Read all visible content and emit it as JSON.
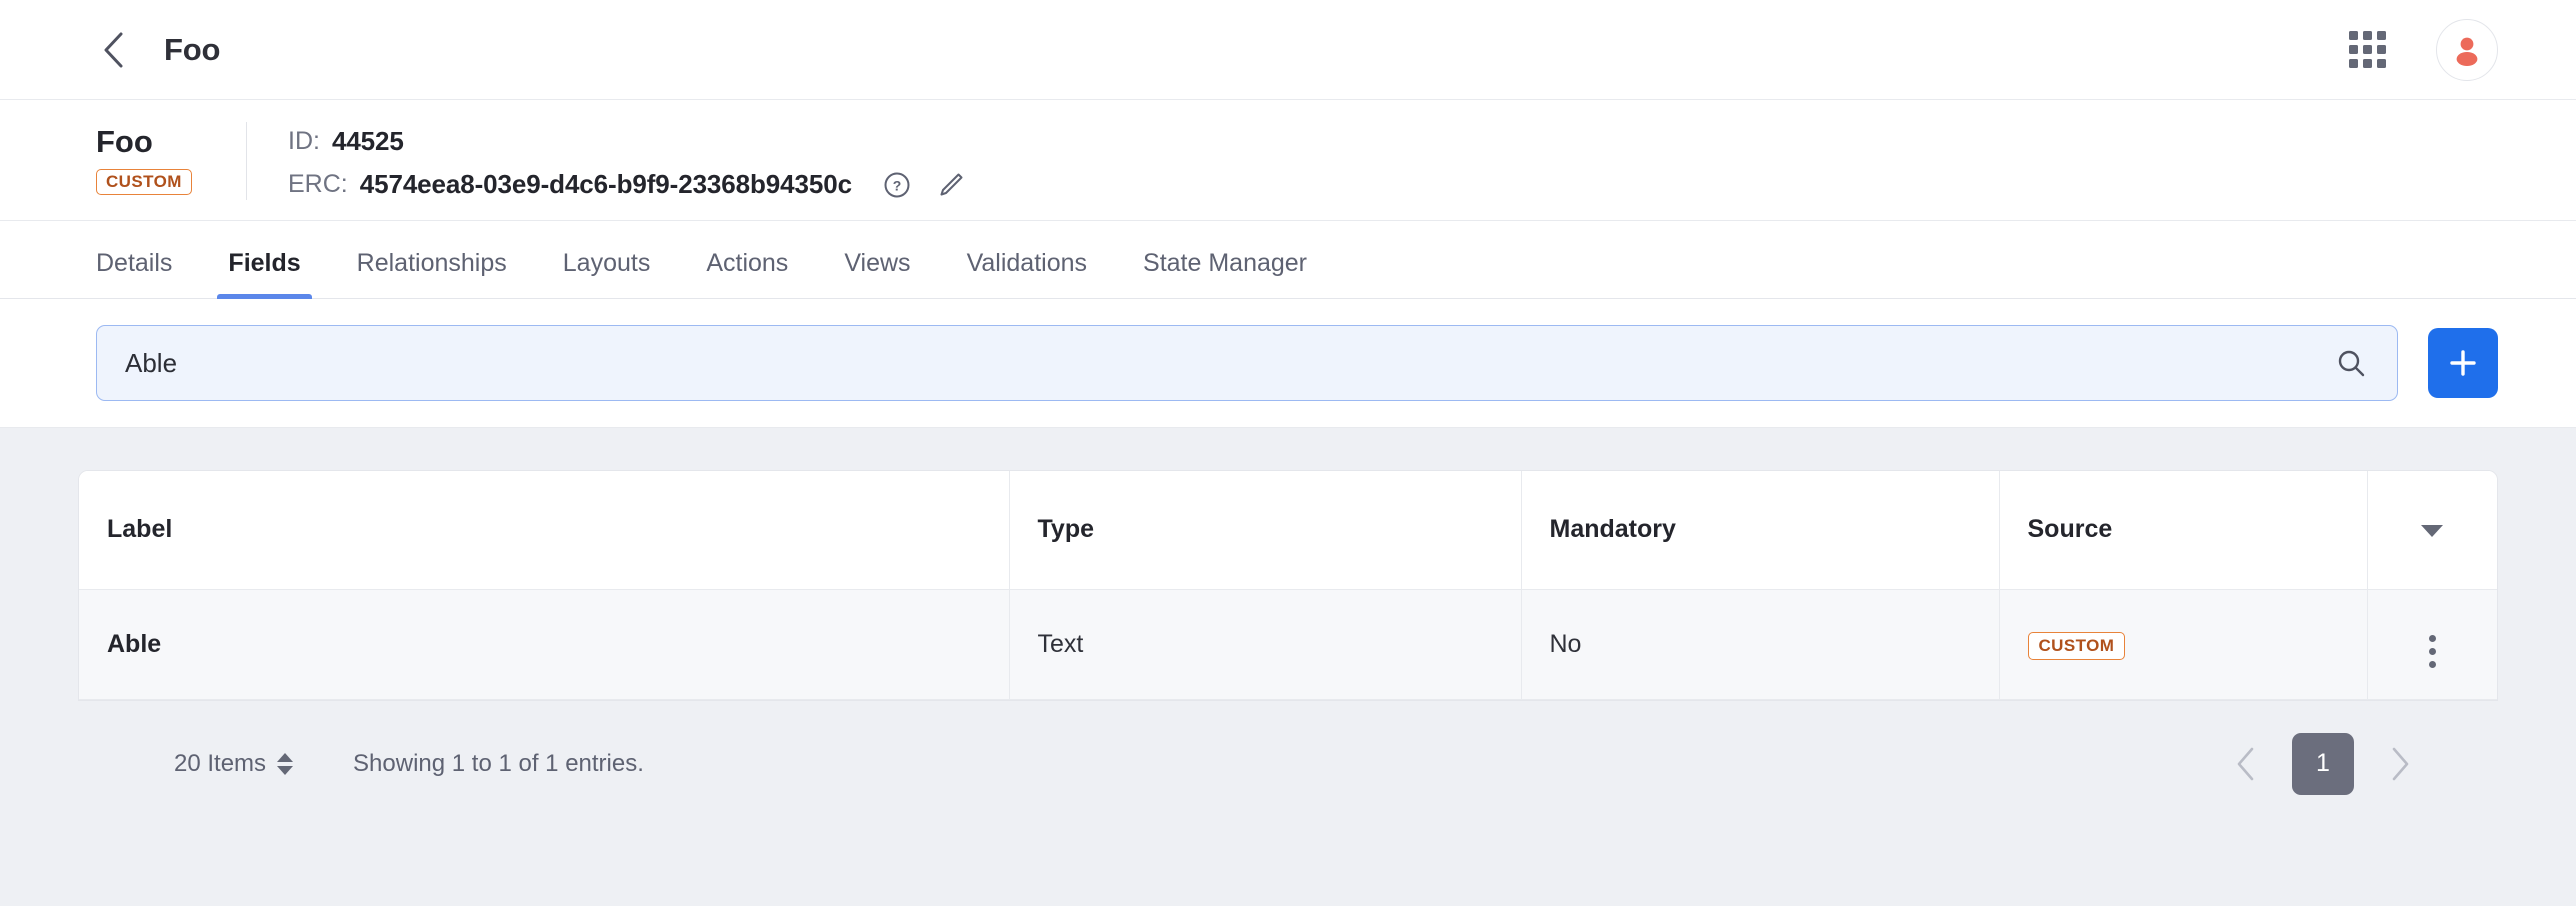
{
  "topbar": {
    "back_icon": "chevron-left-icon",
    "title": "Foo",
    "apps_icon": "grid-apps-icon",
    "avatar_icon": "user-avatar-icon"
  },
  "identity": {
    "name": "Foo",
    "badge": "CUSTOM",
    "id_label": "ID:",
    "id_value": "44525",
    "erc_label": "ERC:",
    "erc_value": "4574eea8-03e9-d4c6-b9f9-23368b94350c",
    "help_icon": "question-circle-icon",
    "edit_icon": "pencil-edit-icon"
  },
  "tabs": [
    {
      "label": "Details",
      "active": false
    },
    {
      "label": "Fields",
      "active": true
    },
    {
      "label": "Relationships",
      "active": false
    },
    {
      "label": "Layouts",
      "active": false
    },
    {
      "label": "Actions",
      "active": false
    },
    {
      "label": "Views",
      "active": false
    },
    {
      "label": "Validations",
      "active": false
    },
    {
      "label": "State Manager",
      "active": false
    }
  ],
  "search": {
    "value": "Able",
    "placeholder": "Search",
    "search_icon": "search-magnifier-icon",
    "add_icon": "plus-icon"
  },
  "table": {
    "columns": [
      "Label",
      "Type",
      "Mandatory",
      "Source"
    ],
    "header_menu_icon": "caret-down-icon",
    "rows": [
      {
        "label": "Able",
        "type": "Text",
        "mandatory": "No",
        "source": "CUSTOM",
        "row_menu_icon": "kebab-menu-icon"
      }
    ]
  },
  "footer": {
    "items_per_page": "20 Items",
    "showing": "Showing 1 to 1 of 1 entries.",
    "prev_icon": "chevron-left-icon",
    "next_icon": "chevron-right-icon",
    "current_page": "1"
  },
  "colors": {
    "accent_blue": "#1f6feb",
    "tab_underline": "#5b87ea",
    "badge_border": "#e8833a",
    "badge_text": "#b0511c",
    "avatar": "#ec6a5a",
    "page_bg": "#eef0f4"
  }
}
